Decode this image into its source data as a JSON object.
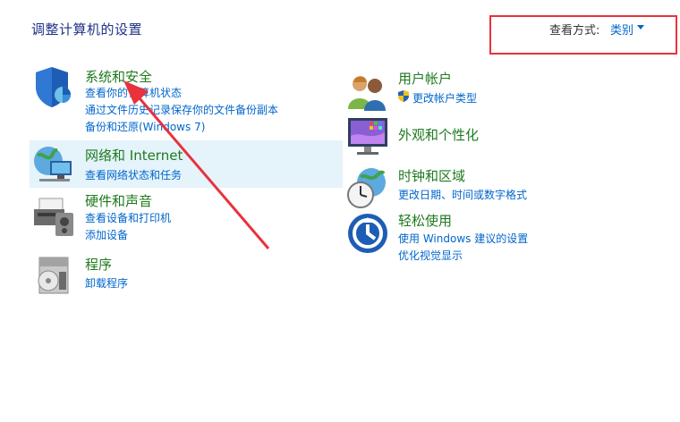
{
  "page": {
    "title": "调整计算机的设置"
  },
  "view_by": {
    "label": "查看方式:",
    "value": "类别"
  },
  "categories": [
    {
      "title": "系统和安全",
      "links": [
        "查看你的计算机状态",
        "通过文件历史记录保存你的文件备份副本",
        "备份和还原(Windows 7)"
      ]
    },
    {
      "title": "网络和 Internet",
      "links": [
        "查看网络状态和任务"
      ]
    },
    {
      "title": "硬件和声音",
      "links": [
        "查看设备和打印机",
        "添加设备"
      ]
    },
    {
      "title": "程序",
      "links": [
        "卸载程序"
      ]
    },
    {
      "title": "用户帐户",
      "links": [
        "更改帐户类型"
      ]
    },
    {
      "title": "外观和个性化",
      "links": []
    },
    {
      "title": "时钟和区域",
      "links": [
        "更改日期、时间或数字格式"
      ]
    },
    {
      "title": "轻松使用",
      "links": [
        "使用 Windows 建议的设置",
        "优化视觉显示"
      ]
    }
  ],
  "colors": {
    "link": "#0066cc",
    "category_title": "#1e7a1e",
    "page_title": "#1e3287",
    "annotation": "#e8323c",
    "hover_bg": "#e5f3fb"
  },
  "icons": [
    "shield-security-icon",
    "network-globe-icon",
    "printer-hardware-icon",
    "programs-disc-icon",
    "users-icon",
    "uac-shield-icon",
    "appearance-monitor-icon",
    "clock-globe-icon",
    "ease-of-access-icon"
  ]
}
